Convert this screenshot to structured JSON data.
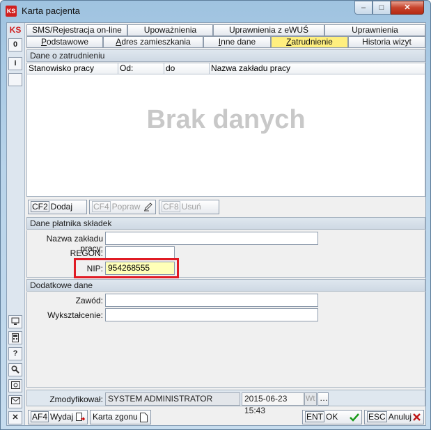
{
  "window": {
    "title": "Karta pacjenta",
    "minimize": "–",
    "maximize": "□",
    "close": "✕"
  },
  "leftbar": {
    "logo": "KS",
    "counter": "0",
    "info": "i",
    "help": "?"
  },
  "tabs_row1": [
    {
      "label": "SMS/Rejestracja on-line"
    },
    {
      "label": "Upoważnienia"
    },
    {
      "label": "Uprawnienia z eWUŚ"
    },
    {
      "label": "Uprawnienia"
    }
  ],
  "tabs_row2": [
    {
      "label_u": "P",
      "label_rest": "odstawowe"
    },
    {
      "label_u": "A",
      "label_rest": "dres zamieszkania"
    },
    {
      "label_u": "I",
      "label_rest": "nne dane"
    },
    {
      "label_u": "Z",
      "label_rest": "atrudnienie",
      "active": true
    },
    {
      "label_u": "",
      "label_rest": "Historia wizyt"
    }
  ],
  "employment": {
    "section_title": "Dane o zatrudnieniu",
    "columns": [
      "Stanowisko pracy",
      "Od:",
      "do",
      "Nazwa zakładu pracy"
    ],
    "empty_text": "Brak danych",
    "add_key": "CF2",
    "add_label": "Dodaj",
    "edit_key": "CF4",
    "edit_label": "Popraw",
    "delete_key": "CF8",
    "delete_label": "Usuń"
  },
  "payer": {
    "section_title": "Dane płatnika składek",
    "company_label": "Nazwa zakładu pracy:",
    "company_value": "",
    "regon_label": "REGON:",
    "regon_value": "",
    "nip_label": "NIP:",
    "nip_value": "954268555"
  },
  "additional": {
    "section_title": "Dodatkowe dane",
    "profession_label": "Zawód:",
    "profession_value": "",
    "education_label": "Wykształcenie:",
    "education_value": ""
  },
  "footer": {
    "modified_label": "Zmodyfikował:",
    "modified_by": "SYSTEM ADMINISTRATOR",
    "modified_at": "2015-06-23 15:43",
    "ws_label": "Wt",
    "print_key": "AF4",
    "print_label": "Wydaj",
    "death_card_label": "Karta zgonu",
    "ok_key": "ENT",
    "ok_label": "OK",
    "cancel_key": "ESC",
    "cancel_label": "Anuluj"
  },
  "colors": {
    "active_tab": "#ffef7f",
    "nip_highlight": "#ffffb8",
    "red_frame": "#e01b24"
  }
}
